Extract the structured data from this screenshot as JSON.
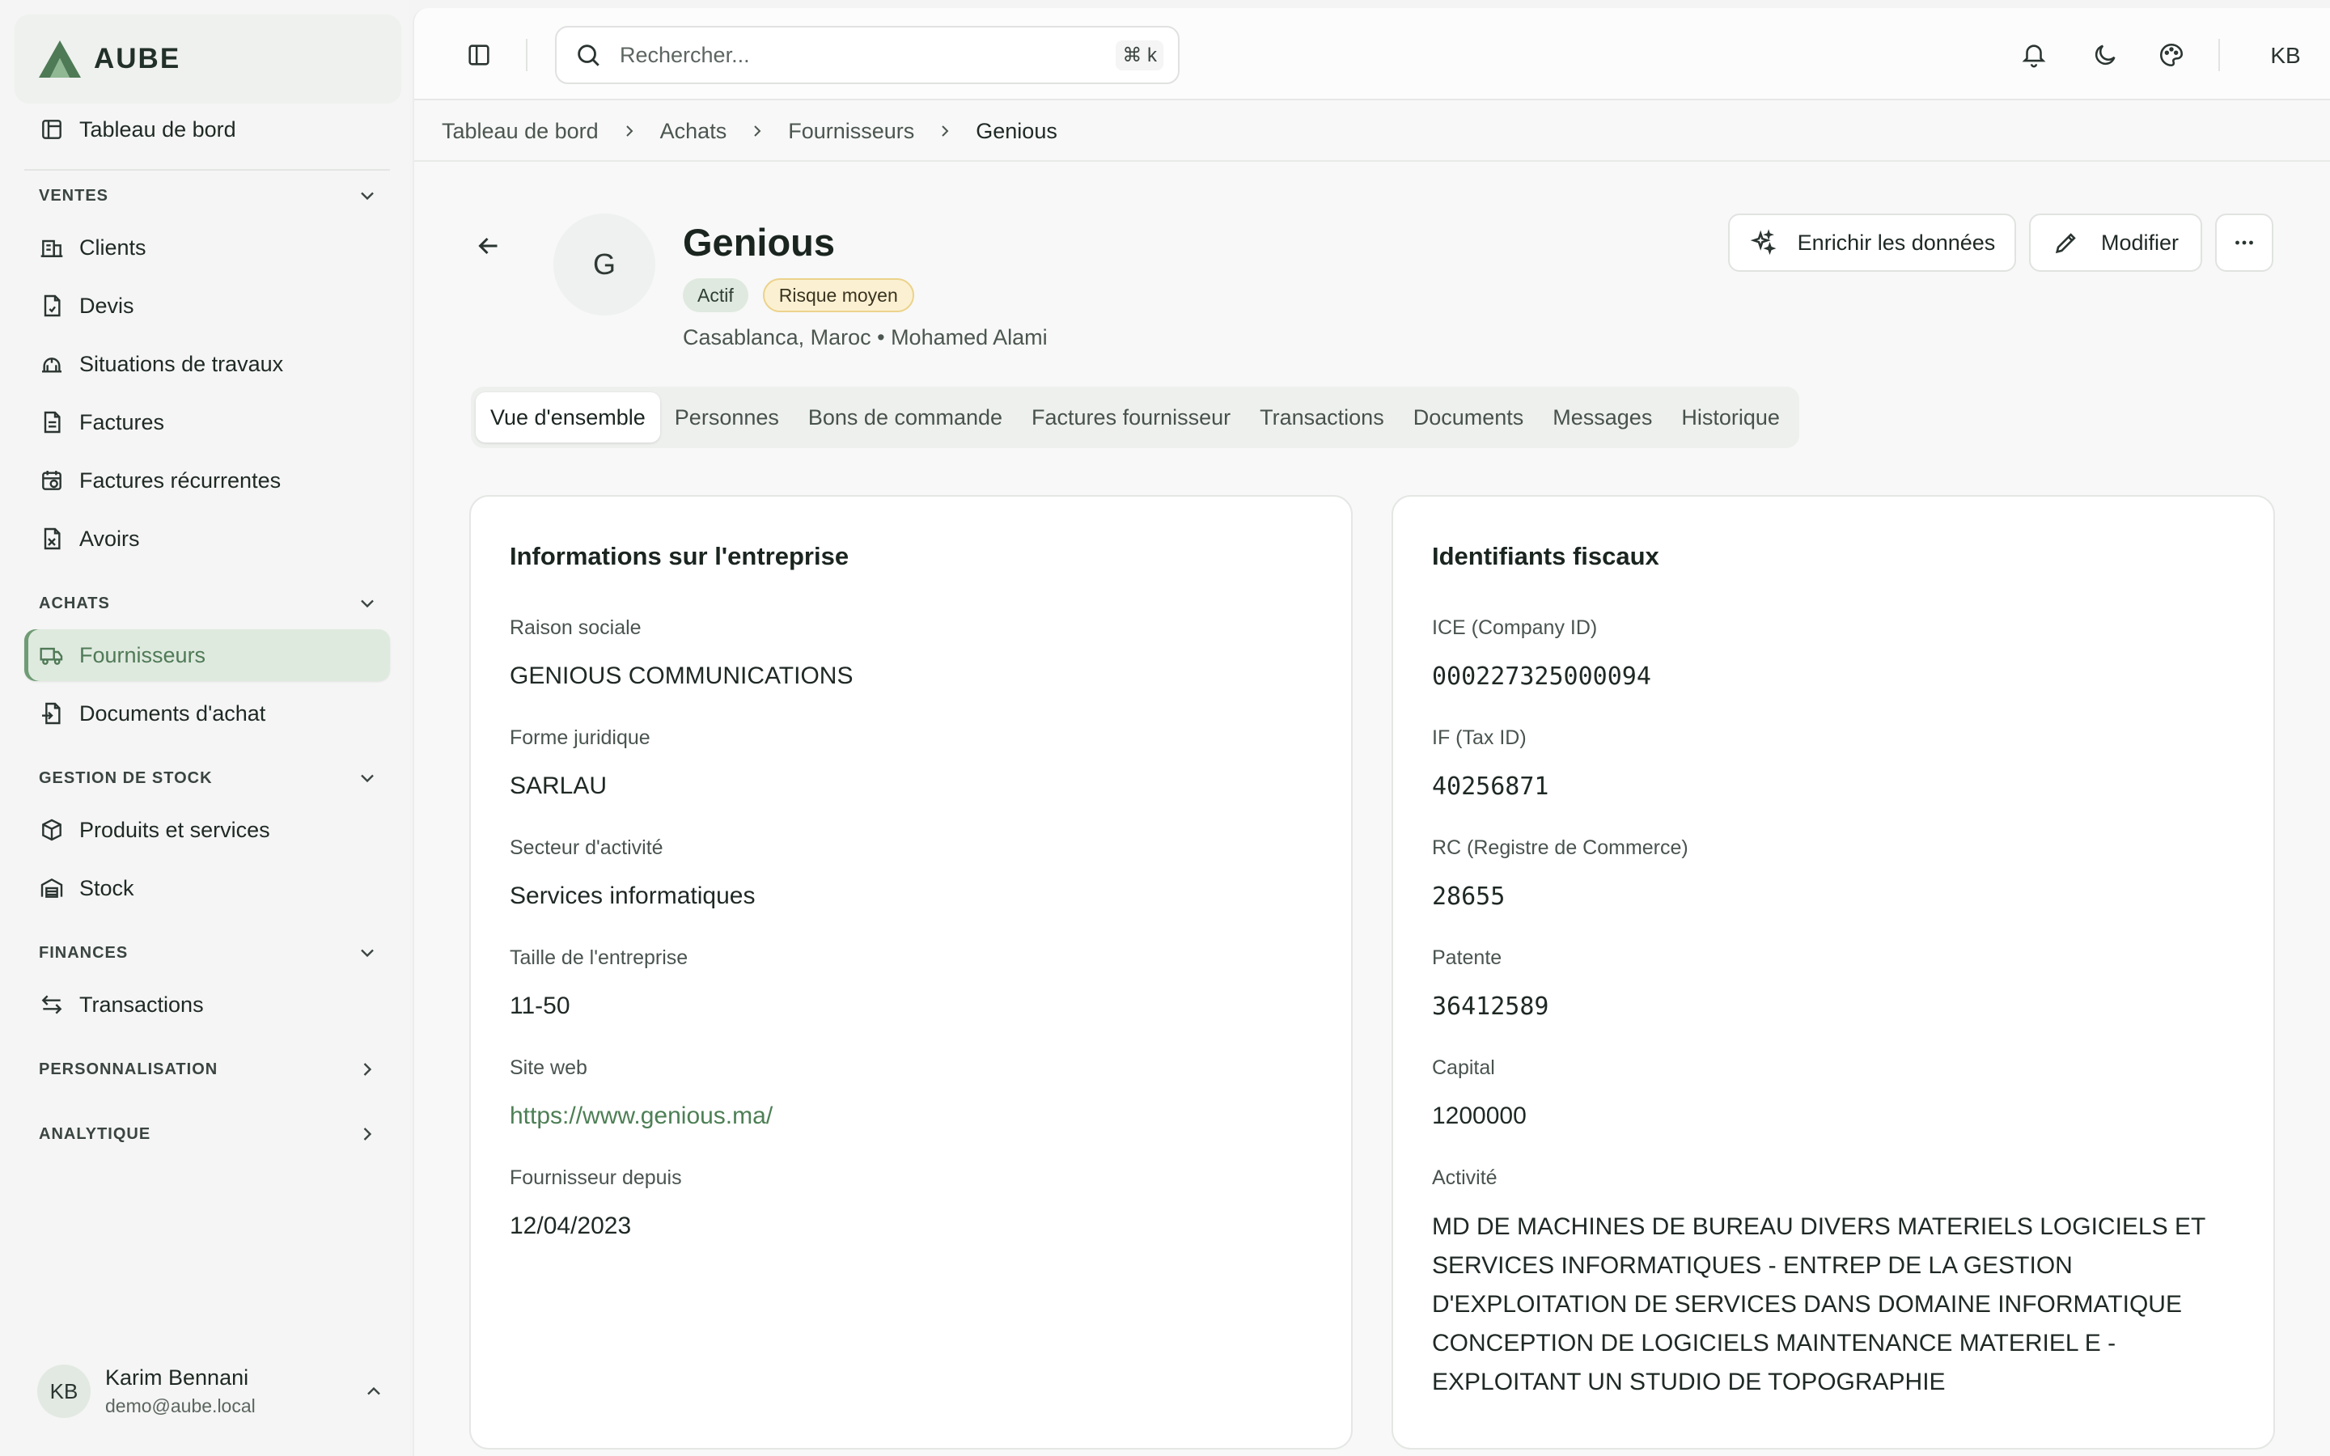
{
  "brand": {
    "name": "AUBE",
    "accent": "#4f7a56"
  },
  "sidebar": {
    "top_item": {
      "label": "Tableau de bord",
      "icon": "dashboard-icon"
    },
    "sections": [
      {
        "title": "VENTES",
        "expanded": true,
        "items": [
          {
            "label": "Clients",
            "icon": "building-icon"
          },
          {
            "label": "Devis",
            "icon": "file-quote-icon"
          },
          {
            "label": "Situations de travaux",
            "icon": "construction-icon"
          },
          {
            "label": "Factures",
            "icon": "invoice-icon"
          },
          {
            "label": "Factures récurrentes",
            "icon": "calendar-repeat-icon"
          },
          {
            "label": "Avoirs",
            "icon": "credit-note-icon"
          }
        ]
      },
      {
        "title": "ACHATS",
        "expanded": true,
        "items": [
          {
            "label": "Fournisseurs",
            "icon": "truck-icon",
            "active": true
          },
          {
            "label": "Documents d'achat",
            "icon": "file-import-icon"
          }
        ]
      },
      {
        "title": "GESTION DE STOCK",
        "expanded": true,
        "items": [
          {
            "label": "Produits et services",
            "icon": "package-icon"
          },
          {
            "label": "Stock",
            "icon": "warehouse-icon"
          }
        ]
      },
      {
        "title": "FINANCES",
        "expanded": true,
        "items": [
          {
            "label": "Transactions",
            "icon": "arrows-exchange-icon"
          }
        ]
      },
      {
        "title": "PERSONNALISATION",
        "expanded": false,
        "items": []
      },
      {
        "title": "ANALYTIQUE",
        "expanded": false,
        "items": []
      }
    ],
    "user": {
      "initials": "KB",
      "name": "Karim Bennani",
      "email": "demo@aube.local"
    }
  },
  "topbar": {
    "search_placeholder": "Rechercher...",
    "search_shortcut": "⌘ k",
    "avatar_initials": "KB"
  },
  "breadcrumb": [
    "Tableau de bord",
    "Achats",
    "Fournisseurs",
    "Genious"
  ],
  "supplier": {
    "avatar_letter": "G",
    "name": "Genious",
    "badges": {
      "status": "Actif",
      "risk": "Risque moyen"
    },
    "subtitle": "Casablanca, Maroc • Mohamed Alami"
  },
  "actions": {
    "enrich": "Enrichir les données",
    "edit": "Modifier"
  },
  "tabs": [
    {
      "label": "Vue d'ensemble",
      "active": true
    },
    {
      "label": "Personnes"
    },
    {
      "label": "Bons de commande"
    },
    {
      "label": "Factures fournisseur"
    },
    {
      "label": "Transactions"
    },
    {
      "label": "Documents"
    },
    {
      "label": "Messages"
    },
    {
      "label": "Historique"
    }
  ],
  "company_card": {
    "title": "Informations sur l'entreprise",
    "fields": [
      {
        "label": "Raison sociale",
        "value": "GENIOUS COMMUNICATIONS"
      },
      {
        "label": "Forme juridique",
        "value": "SARLAU"
      },
      {
        "label": "Secteur d'activité",
        "value": "Services informatiques"
      },
      {
        "label": "Taille de l'entreprise",
        "value": "11-50"
      },
      {
        "label": "Site web",
        "value": "https://www.genious.ma/"
      },
      {
        "label": "Fournisseur depuis",
        "value": "12/04/2023"
      }
    ]
  },
  "tax_card": {
    "title": "Identifiants fiscaux",
    "fields": [
      {
        "label": "ICE (Company ID)",
        "value": "000227325000094"
      },
      {
        "label": "IF (Tax ID)",
        "value": "40256871"
      },
      {
        "label": "RC (Registre de Commerce)",
        "value": "28655"
      },
      {
        "label": "Patente",
        "value": "36412589"
      },
      {
        "label": "Capital",
        "value": "1200000"
      },
      {
        "label": "Activité",
        "value": "MD DE MACHINES DE BUREAU DIVERS MATERIELS LOGICIELS ET SERVICES INFORMATIQUES - ENTREP DE LA GESTION D'EXPLOITATION DE SERVICES DANS DOMAINE INFORMATIQUE CONCEPTION DE LOGICIELS MAINTENANCE MATERIEL E - EXPLOITANT UN STUDIO DE TOPOGRAPHIE"
      }
    ]
  }
}
